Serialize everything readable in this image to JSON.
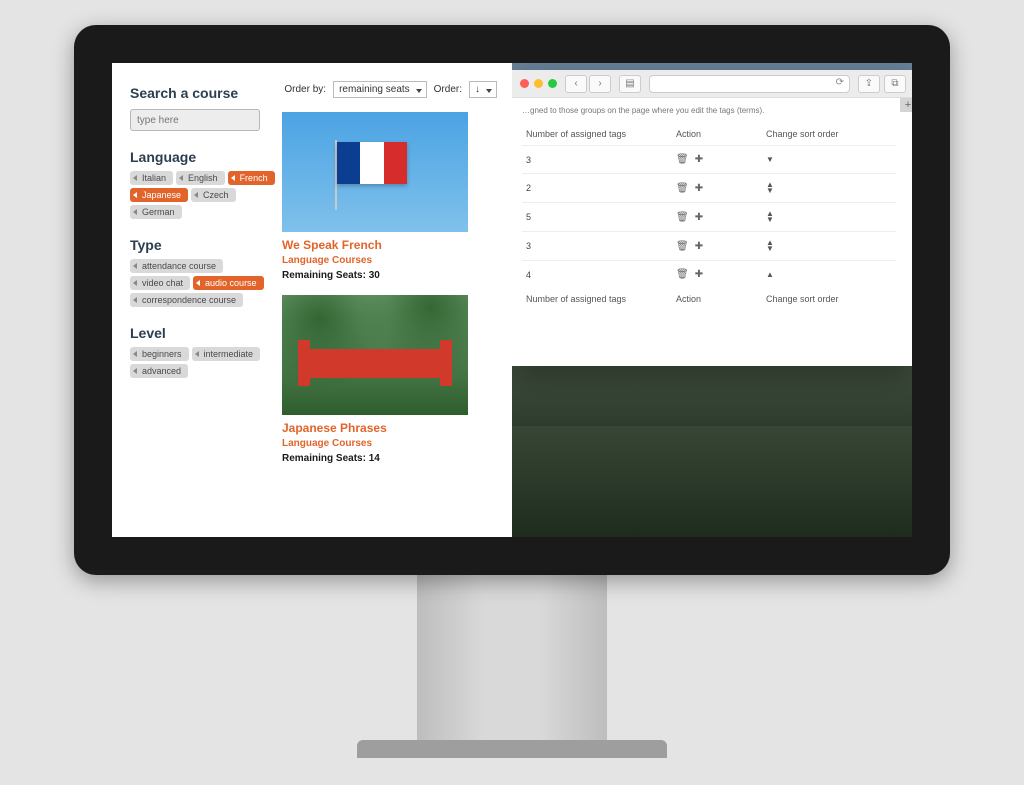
{
  "sidebar": {
    "search_heading": "Search a course",
    "search_placeholder": "type here",
    "sections": {
      "language": {
        "heading": "Language",
        "tags": [
          {
            "label": "Italian",
            "active": false
          },
          {
            "label": "English",
            "active": false
          },
          {
            "label": "French",
            "active": true
          },
          {
            "label": "Japanese",
            "active": true
          },
          {
            "label": "Czech",
            "active": false
          },
          {
            "label": "German",
            "active": false
          }
        ]
      },
      "type": {
        "heading": "Type",
        "tags": [
          {
            "label": "attendance course",
            "active": false
          },
          {
            "label": "video chat",
            "active": false
          },
          {
            "label": "audio course",
            "active": true
          },
          {
            "label": "correspondence course",
            "active": false
          }
        ]
      },
      "level": {
        "heading": "Level",
        "tags": [
          {
            "label": "beginners",
            "active": false
          },
          {
            "label": "intermediate",
            "active": false
          },
          {
            "label": "advanced",
            "active": false
          }
        ]
      }
    }
  },
  "orderbar": {
    "order_by_label": "Order by:",
    "order_by_value": "remaining seats",
    "order_label": "Order:",
    "order_value": "↓"
  },
  "results": [
    {
      "title": "We Speak French",
      "subtitle": "Language Courses",
      "seats_label": "Remaining Seats: 30"
    },
    {
      "title": "Japanese Phrases",
      "subtitle": "Language Courses",
      "seats_label": "Remaining Seats: 14"
    }
  ],
  "safari": {
    "hint": "…gned to those groups on the page where you edit the tags (terms).",
    "columns": {
      "c1": "Number of assigned tags",
      "c2": "Action",
      "c3": "Change sort order"
    },
    "rows": [
      {
        "count": "3",
        "arrows": "down"
      },
      {
        "count": "2",
        "arrows": "both"
      },
      {
        "count": "5",
        "arrows": "both"
      },
      {
        "count": "3",
        "arrows": "both"
      },
      {
        "count": "4",
        "arrows": "up"
      }
    ],
    "footer": {
      "c1": "Number of assigned tags",
      "c2": "Action",
      "c3": "Change sort order"
    }
  }
}
